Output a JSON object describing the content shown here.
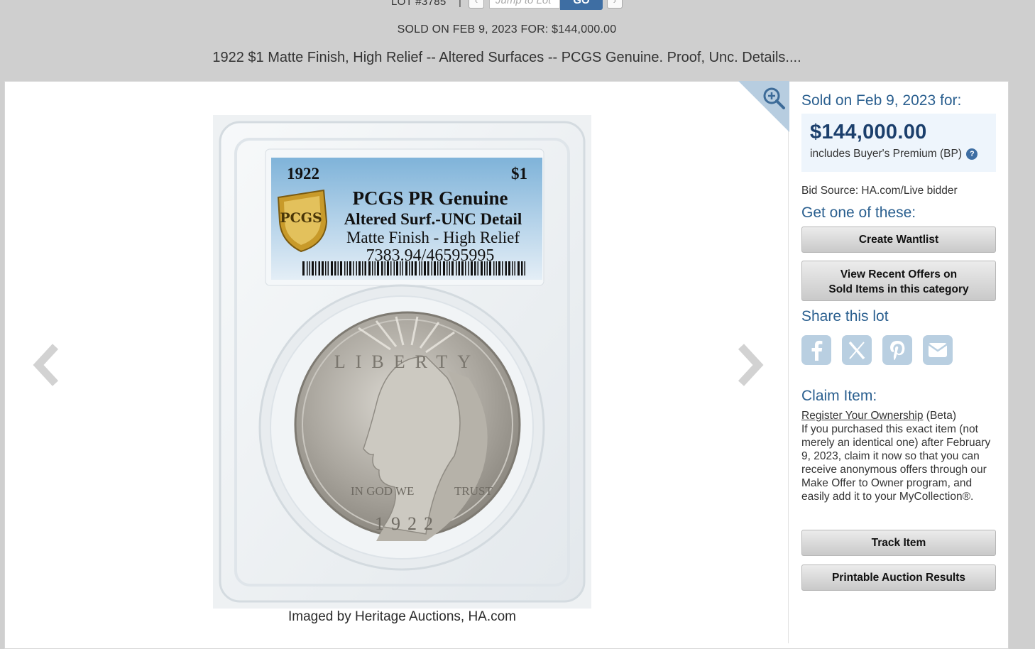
{
  "header": {
    "lot_label": "LOT #3785",
    "pipe": "|",
    "jump_placeholder": "Jump to Lot",
    "go_label": "GO",
    "sold_line": "SOLD ON FEB 9, 2023 FOR: $144,000.00",
    "title": "1922 $1 Matte Finish, High Relief -- Altered Surfaces -- PCGS Genuine. Proof, Unc. Details...."
  },
  "image": {
    "label_lines": {
      "year": "1922",
      "denom": "$1",
      "grade": "PCGS PR Genuine",
      "detail": "Altered Surf.-UNC Detail",
      "finish": "Matte Finish - High Relief",
      "cert": "7383.94/46595995"
    },
    "caption": "Imaged by Heritage Auctions, HA.com"
  },
  "sidebar": {
    "sold_head": "Sold on Feb 9, 2023 for:",
    "price": "$144,000.00",
    "bp_text": "includes Buyer's Premium (BP)",
    "bid_source": "Bid Source: HA.com/Live bidder",
    "get_one_head": "Get one of these:",
    "wantlist_label": "Create Wantlist",
    "recent_offers_line1": "View Recent Offers on",
    "recent_offers_line2": "Sold Items in this category",
    "share_head": "Share this lot",
    "claim_head": "Claim Item:",
    "claim_link": "Register Your Ownership",
    "claim_beta": "(Beta)",
    "claim_body": "If you purchased this exact item (not merely an identical one) after February 9, 2023, claim it now so that you can receive anonymous offers through our Make Offer to Owner program, and easily add it to your MyCollection®.",
    "track_label": "Track Item",
    "printable_label": "Printable Auction Results"
  },
  "colors": {
    "accent": "#2a5f8f",
    "go_button": "#3e6ea3",
    "price_box": "#eef5fc",
    "share_icon_bg": "#b9cfe1"
  }
}
